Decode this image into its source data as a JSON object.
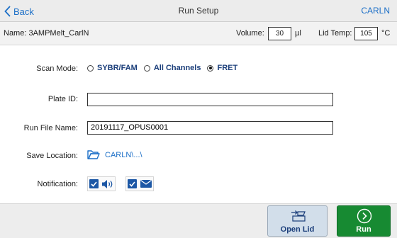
{
  "header": {
    "back_label": "Back",
    "title": "Run Setup",
    "user": "CARLN"
  },
  "infobar": {
    "name": "Name: 3AMPMelt_CarlN",
    "volume_label": "Volume:",
    "volume_value": "30",
    "volume_unit": "µl",
    "lid_temp_label": "Lid Temp:",
    "lid_temp_value": "105",
    "lid_temp_unit": "°C"
  },
  "form": {
    "scan_mode_label": "Scan Mode:",
    "scan_modes": [
      {
        "label": "SYBR/FAM",
        "selected": false
      },
      {
        "label": "All Channels",
        "selected": false
      },
      {
        "label": "FRET",
        "selected": true
      }
    ],
    "plate_id_label": "Plate ID:",
    "plate_id_value": "",
    "run_file_label": "Run File Name:",
    "run_file_value": "20191117_OPUS0001",
    "save_location_label": "Save Location:",
    "save_location_value": "CARLN\\...\\",
    "notification_label": "Notification:",
    "notifications": [
      {
        "icon": "speaker-icon",
        "checked": true
      },
      {
        "icon": "envelope-icon",
        "checked": true
      }
    ]
  },
  "actions": {
    "open_lid_label": "Open Lid",
    "run_label": "Run"
  },
  "colors": {
    "accent": "#1c6fc7",
    "run_button": "#178a32",
    "open_lid_button": "#d2deea"
  }
}
